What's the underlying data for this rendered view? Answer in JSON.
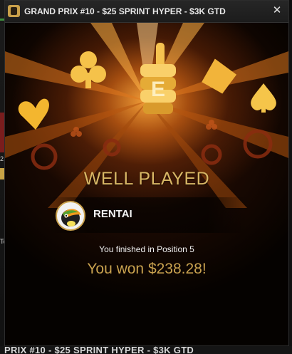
{
  "window": {
    "title": "GRAND PRIX #10 - $25 SPRINT HYPER - $3K GTD",
    "close_glyph": "✕"
  },
  "result": {
    "heading": "WELL PLAYED",
    "player_name": "RENTAI",
    "finish_text": "You finished in Position 5",
    "won_text": "You won $238.28!"
  },
  "background": {
    "bottom_title": "PRIX #10 - $25 SPRINT HYPER - $3K GTD",
    "left_number": "2",
    "left_fragment": "To"
  },
  "colors": {
    "gold": "#d8b765",
    "glow": "#ffa83c"
  }
}
